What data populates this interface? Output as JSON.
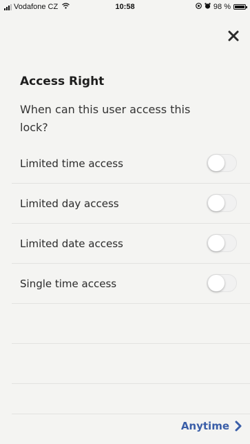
{
  "status_bar": {
    "carrier": "Vodafone CZ",
    "time": "10:58",
    "battery": "98 %",
    "icons": [
      "signal-icon",
      "wifi-icon",
      "location-icon",
      "alarm-icon",
      "battery-icon"
    ]
  },
  "header": {
    "close_icon": "close-icon"
  },
  "main": {
    "title": "Access Right",
    "subtitle": "When can this user access this lock?",
    "options": [
      {
        "label": "Limited time access",
        "enabled": false
      },
      {
        "label": "Limited day access",
        "enabled": false
      },
      {
        "label": "Limited date access",
        "enabled": false
      },
      {
        "label": "Single time access",
        "enabled": false
      }
    ]
  },
  "footer": {
    "label": "Anytime",
    "icon": "chevron-right-icon"
  },
  "colors": {
    "background": "#f4f4f2",
    "accent": "#3a5ea8",
    "divider": "#e2e2e0",
    "text": "#2a2a2a"
  }
}
